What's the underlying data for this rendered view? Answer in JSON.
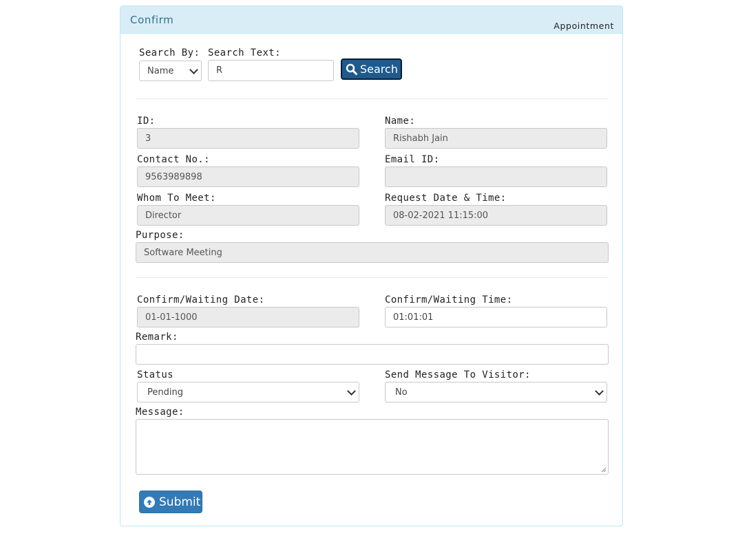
{
  "header": {
    "title": "Confirm",
    "section": "Appointment"
  },
  "search": {
    "by_label": "Search By:",
    "by_value": "Name",
    "text_label": "Search Text:",
    "text_value": "R",
    "button_label": "Search"
  },
  "visitor": {
    "id_label": "ID:",
    "id_value": "3",
    "name_label": "Name:",
    "name_value": "Rishabh Jain",
    "contact_label": "Contact No.:",
    "contact_value": "9563989898",
    "email_label": "Email ID:",
    "email_value": "",
    "whom_label": "Whom To Meet:",
    "whom_value": "Director",
    "request_label": "Request Date & Time:",
    "request_value": "08-02-2021 11:15:00",
    "purpose_label": "Purpose:",
    "purpose_value": "Software Meeting"
  },
  "confirm": {
    "date_label": "Confirm/Waiting Date:",
    "date_value": "01-01-1000",
    "time_label": "Confirm/Waiting Time:",
    "time_value": "01:01:01",
    "remark_label": "Remark:",
    "remark_value": "",
    "status_label": "Status",
    "status_value": "Pending",
    "send_label": "Send Message To Visitor:",
    "send_value": "No",
    "message_label": "Message:",
    "message_value": "",
    "submit_label": "Submit"
  },
  "colors": {
    "heading_bg": "#d9edf7",
    "heading_text": "#31708f",
    "primary": "#337ab7",
    "search_btn": "#1e5a8c"
  },
  "icons": {
    "search": "magnifier-icon",
    "submit": "circle-arrow-up-icon"
  }
}
